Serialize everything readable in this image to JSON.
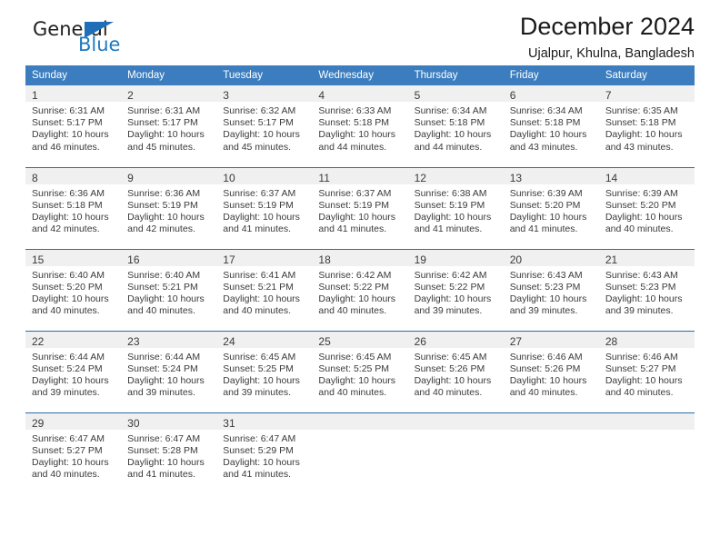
{
  "brand": {
    "name_part1": "General",
    "name_part2": "Blue",
    "accent_color": "#1f6fb8"
  },
  "header": {
    "title": "December 2024",
    "subtitle": "Ujalpur, Khulna, Bangladesh"
  },
  "calendar": {
    "header_bg": "#3c7dbf",
    "row_rule_color": "#2b6ca8",
    "daynum_bg": "#f0f0f0",
    "weekday_headers": [
      "Sunday",
      "Monday",
      "Tuesday",
      "Wednesday",
      "Thursday",
      "Friday",
      "Saturday"
    ],
    "weeks": [
      [
        {
          "day": "1",
          "sunrise": "Sunrise: 6:31 AM",
          "sunset": "Sunset: 5:17 PM",
          "daylight_line1": "Daylight: 10 hours",
          "daylight_line2": "and 46 minutes."
        },
        {
          "day": "2",
          "sunrise": "Sunrise: 6:31 AM",
          "sunset": "Sunset: 5:17 PM",
          "daylight_line1": "Daylight: 10 hours",
          "daylight_line2": "and 45 minutes."
        },
        {
          "day": "3",
          "sunrise": "Sunrise: 6:32 AM",
          "sunset": "Sunset: 5:17 PM",
          "daylight_line1": "Daylight: 10 hours",
          "daylight_line2": "and 45 minutes."
        },
        {
          "day": "4",
          "sunrise": "Sunrise: 6:33 AM",
          "sunset": "Sunset: 5:18 PM",
          "daylight_line1": "Daylight: 10 hours",
          "daylight_line2": "and 44 minutes."
        },
        {
          "day": "5",
          "sunrise": "Sunrise: 6:34 AM",
          "sunset": "Sunset: 5:18 PM",
          "daylight_line1": "Daylight: 10 hours",
          "daylight_line2": "and 44 minutes."
        },
        {
          "day": "6",
          "sunrise": "Sunrise: 6:34 AM",
          "sunset": "Sunset: 5:18 PM",
          "daylight_line1": "Daylight: 10 hours",
          "daylight_line2": "and 43 minutes."
        },
        {
          "day": "7",
          "sunrise": "Sunrise: 6:35 AM",
          "sunset": "Sunset: 5:18 PM",
          "daylight_line1": "Daylight: 10 hours",
          "daylight_line2": "and 43 minutes."
        }
      ],
      [
        {
          "day": "8",
          "sunrise": "Sunrise: 6:36 AM",
          "sunset": "Sunset: 5:18 PM",
          "daylight_line1": "Daylight: 10 hours",
          "daylight_line2": "and 42 minutes."
        },
        {
          "day": "9",
          "sunrise": "Sunrise: 6:36 AM",
          "sunset": "Sunset: 5:19 PM",
          "daylight_line1": "Daylight: 10 hours",
          "daylight_line2": "and 42 minutes."
        },
        {
          "day": "10",
          "sunrise": "Sunrise: 6:37 AM",
          "sunset": "Sunset: 5:19 PM",
          "daylight_line1": "Daylight: 10 hours",
          "daylight_line2": "and 41 minutes."
        },
        {
          "day": "11",
          "sunrise": "Sunrise: 6:37 AM",
          "sunset": "Sunset: 5:19 PM",
          "daylight_line1": "Daylight: 10 hours",
          "daylight_line2": "and 41 minutes."
        },
        {
          "day": "12",
          "sunrise": "Sunrise: 6:38 AM",
          "sunset": "Sunset: 5:19 PM",
          "daylight_line1": "Daylight: 10 hours",
          "daylight_line2": "and 41 minutes."
        },
        {
          "day": "13",
          "sunrise": "Sunrise: 6:39 AM",
          "sunset": "Sunset: 5:20 PM",
          "daylight_line1": "Daylight: 10 hours",
          "daylight_line2": "and 41 minutes."
        },
        {
          "day": "14",
          "sunrise": "Sunrise: 6:39 AM",
          "sunset": "Sunset: 5:20 PM",
          "daylight_line1": "Daylight: 10 hours",
          "daylight_line2": "and 40 minutes."
        }
      ],
      [
        {
          "day": "15",
          "sunrise": "Sunrise: 6:40 AM",
          "sunset": "Sunset: 5:20 PM",
          "daylight_line1": "Daylight: 10 hours",
          "daylight_line2": "and 40 minutes."
        },
        {
          "day": "16",
          "sunrise": "Sunrise: 6:40 AM",
          "sunset": "Sunset: 5:21 PM",
          "daylight_line1": "Daylight: 10 hours",
          "daylight_line2": "and 40 minutes."
        },
        {
          "day": "17",
          "sunrise": "Sunrise: 6:41 AM",
          "sunset": "Sunset: 5:21 PM",
          "daylight_line1": "Daylight: 10 hours",
          "daylight_line2": "and 40 minutes."
        },
        {
          "day": "18",
          "sunrise": "Sunrise: 6:42 AM",
          "sunset": "Sunset: 5:22 PM",
          "daylight_line1": "Daylight: 10 hours",
          "daylight_line2": "and 40 minutes."
        },
        {
          "day": "19",
          "sunrise": "Sunrise: 6:42 AM",
          "sunset": "Sunset: 5:22 PM",
          "daylight_line1": "Daylight: 10 hours",
          "daylight_line2": "and 39 minutes."
        },
        {
          "day": "20",
          "sunrise": "Sunrise: 6:43 AM",
          "sunset": "Sunset: 5:23 PM",
          "daylight_line1": "Daylight: 10 hours",
          "daylight_line2": "and 39 minutes."
        },
        {
          "day": "21",
          "sunrise": "Sunrise: 6:43 AM",
          "sunset": "Sunset: 5:23 PM",
          "daylight_line1": "Daylight: 10 hours",
          "daylight_line2": "and 39 minutes."
        }
      ],
      [
        {
          "day": "22",
          "sunrise": "Sunrise: 6:44 AM",
          "sunset": "Sunset: 5:24 PM",
          "daylight_line1": "Daylight: 10 hours",
          "daylight_line2": "and 39 minutes."
        },
        {
          "day": "23",
          "sunrise": "Sunrise: 6:44 AM",
          "sunset": "Sunset: 5:24 PM",
          "daylight_line1": "Daylight: 10 hours",
          "daylight_line2": "and 39 minutes."
        },
        {
          "day": "24",
          "sunrise": "Sunrise: 6:45 AM",
          "sunset": "Sunset: 5:25 PM",
          "daylight_line1": "Daylight: 10 hours",
          "daylight_line2": "and 39 minutes."
        },
        {
          "day": "25",
          "sunrise": "Sunrise: 6:45 AM",
          "sunset": "Sunset: 5:25 PM",
          "daylight_line1": "Daylight: 10 hours",
          "daylight_line2": "and 40 minutes."
        },
        {
          "day": "26",
          "sunrise": "Sunrise: 6:45 AM",
          "sunset": "Sunset: 5:26 PM",
          "daylight_line1": "Daylight: 10 hours",
          "daylight_line2": "and 40 minutes."
        },
        {
          "day": "27",
          "sunrise": "Sunrise: 6:46 AM",
          "sunset": "Sunset: 5:26 PM",
          "daylight_line1": "Daylight: 10 hours",
          "daylight_line2": "and 40 minutes."
        },
        {
          "day": "28",
          "sunrise": "Sunrise: 6:46 AM",
          "sunset": "Sunset: 5:27 PM",
          "daylight_line1": "Daylight: 10 hours",
          "daylight_line2": "and 40 minutes."
        }
      ],
      [
        {
          "day": "29",
          "sunrise": "Sunrise: 6:47 AM",
          "sunset": "Sunset: 5:27 PM",
          "daylight_line1": "Daylight: 10 hours",
          "daylight_line2": "and 40 minutes."
        },
        {
          "day": "30",
          "sunrise": "Sunrise: 6:47 AM",
          "sunset": "Sunset: 5:28 PM",
          "daylight_line1": "Daylight: 10 hours",
          "daylight_line2": "and 41 minutes."
        },
        {
          "day": "31",
          "sunrise": "Sunrise: 6:47 AM",
          "sunset": "Sunset: 5:29 PM",
          "daylight_line1": "Daylight: 10 hours",
          "daylight_line2": "and 41 minutes."
        },
        {
          "day": "",
          "sunrise": "",
          "sunset": "",
          "daylight_line1": "",
          "daylight_line2": ""
        },
        {
          "day": "",
          "sunrise": "",
          "sunset": "",
          "daylight_line1": "",
          "daylight_line2": ""
        },
        {
          "day": "",
          "sunrise": "",
          "sunset": "",
          "daylight_line1": "",
          "daylight_line2": ""
        },
        {
          "day": "",
          "sunrise": "",
          "sunset": "",
          "daylight_line1": "",
          "daylight_line2": ""
        }
      ]
    ]
  }
}
